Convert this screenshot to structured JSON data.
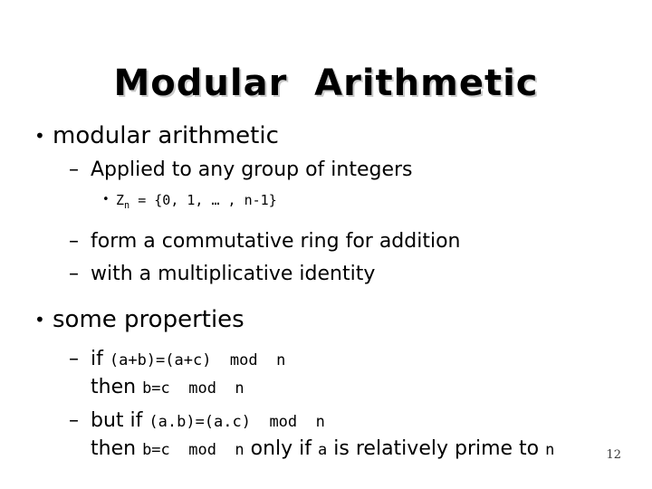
{
  "slide": {
    "title": "Modular  Arithmetic",
    "page_number": "12",
    "bullet_marker_level1": "•",
    "bullet_marker_level2": "–",
    "bullet_marker_level3": "•"
  },
  "content": {
    "item1": {
      "text": "modular arithmetic",
      "sub1": "Applied to any group of integers",
      "sub1_code": {
        "symbol": "Z",
        "subscript": "n",
        "expression": " = {0, 1, … , n-1}"
      },
      "sub2": "form a commutative ring for addition",
      "sub3": "with a multiplicative identity"
    },
    "item2": {
      "text": "some properties",
      "prop1": {
        "lead": "if",
        "code1": "(a+b)=(a+c)  mod  n",
        "then_word": "then",
        "code2": "b=c  mod  n"
      },
      "prop2": {
        "lead": "but if",
        "code1": "(a.b)=(a.c)  mod  n",
        "then_word": "then",
        "code2": "b=c  mod  n",
        "mid1": "only if",
        "code3": "a",
        "mid2": "is relatively prime to",
        "code4": "n"
      }
    }
  }
}
